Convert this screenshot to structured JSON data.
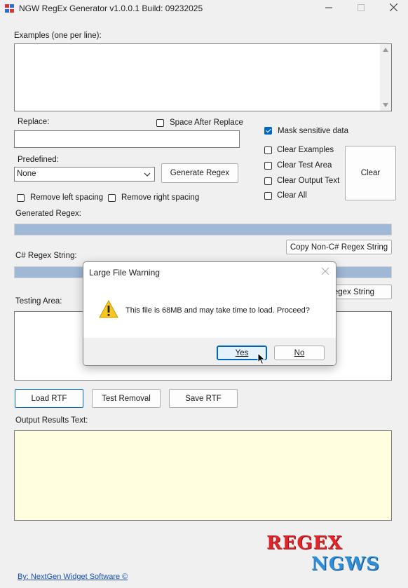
{
  "window": {
    "title": "NGW RegEx Generator v1.0.0.1 Build: 09232025",
    "minimize_icon": "minimize-icon",
    "maximize_icon": "maximize-icon",
    "close_icon": "close-icon"
  },
  "examples": {
    "label": "Examples (one per line):",
    "value": ""
  },
  "replace": {
    "label": "Replace:",
    "value": "",
    "space_after_label": "Space After Replace",
    "space_after_checked": false
  },
  "mask": {
    "label": "Mask sensitive data",
    "checked": true
  },
  "clear_options": [
    {
      "label": "Clear Examples",
      "checked": false
    },
    {
      "label": "Clear Test Area",
      "checked": false
    },
    {
      "label": "Clear Output Text",
      "checked": false
    },
    {
      "label": "Clear All",
      "checked": false
    }
  ],
  "clear_button": "Clear",
  "predefined": {
    "label": "Predefined:",
    "selected": "None"
  },
  "generate_button": "Generate Regex",
  "spacing": {
    "remove_left": "Remove left spacing",
    "remove_right": "Remove right spacing"
  },
  "generated_regex": {
    "label": "Generated Regex:",
    "value": ""
  },
  "copy_noncs_button": "Copy Non-C# Regex String",
  "cs_regex": {
    "label": "C# Regex String:",
    "value": ""
  },
  "copy_cs_button_partial": "egex String",
  "testing_area": {
    "label": "Testing Area:",
    "value": ""
  },
  "buttons": {
    "load_rtf": "Load RTF",
    "test_removal": "Test Removal",
    "save_rtf": "Save RTF"
  },
  "output": {
    "label": "Output Results Text:",
    "value": ""
  },
  "footer": {
    "link": "By: NextGen Widget Software  ©"
  },
  "logo": {
    "line1": "REGEX",
    "line2": "NGWS"
  },
  "dialog": {
    "title": "Large File Warning",
    "message": "This file is 68MB and may take time to load. Proceed?",
    "icon": "warning-icon",
    "yes": "Yes",
    "no": "No"
  },
  "colors": {
    "accent": "#0067c0",
    "regex_bar": "#9eb8d6",
    "output_bg": "#ffffe0",
    "logo_red": "#e0262b",
    "logo_green": "#33b04a",
    "logo_blue": "#2e8fd8"
  }
}
